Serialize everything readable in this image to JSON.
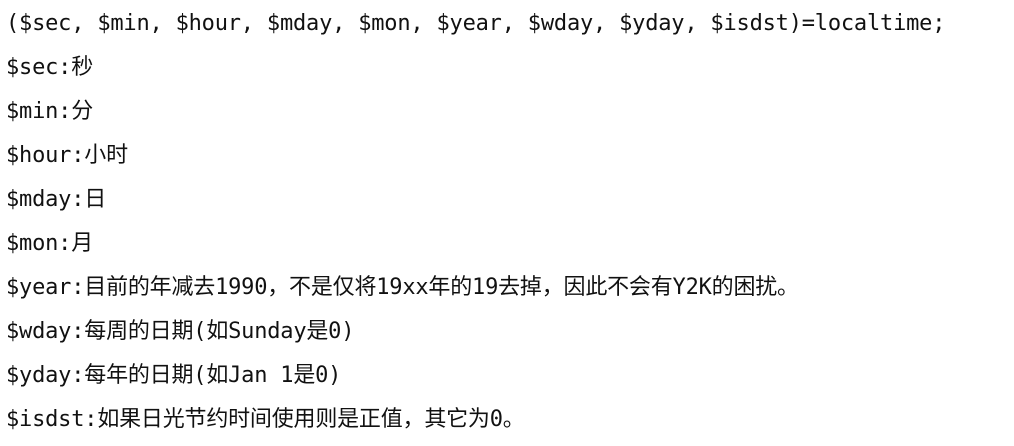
{
  "document": {
    "lines": [
      "($sec, $min, $hour, $mday, $mon, $year, $wday, $yday, $isdst)=localtime;",
      "$sec:秒",
      "$min:分",
      "$hour:小时",
      "$mday:日",
      "$mon:月",
      "$year:目前的年减去1990，不是仅将19xx年的19去掉，因此不会有Y2K的困扰。",
      "$wday:每周的日期(如Sunday是0)",
      "$yday:每年的日期(如Jan 1是0)",
      "$isdst:如果日光节约时间使用则是正值，其它为0。"
    ]
  }
}
